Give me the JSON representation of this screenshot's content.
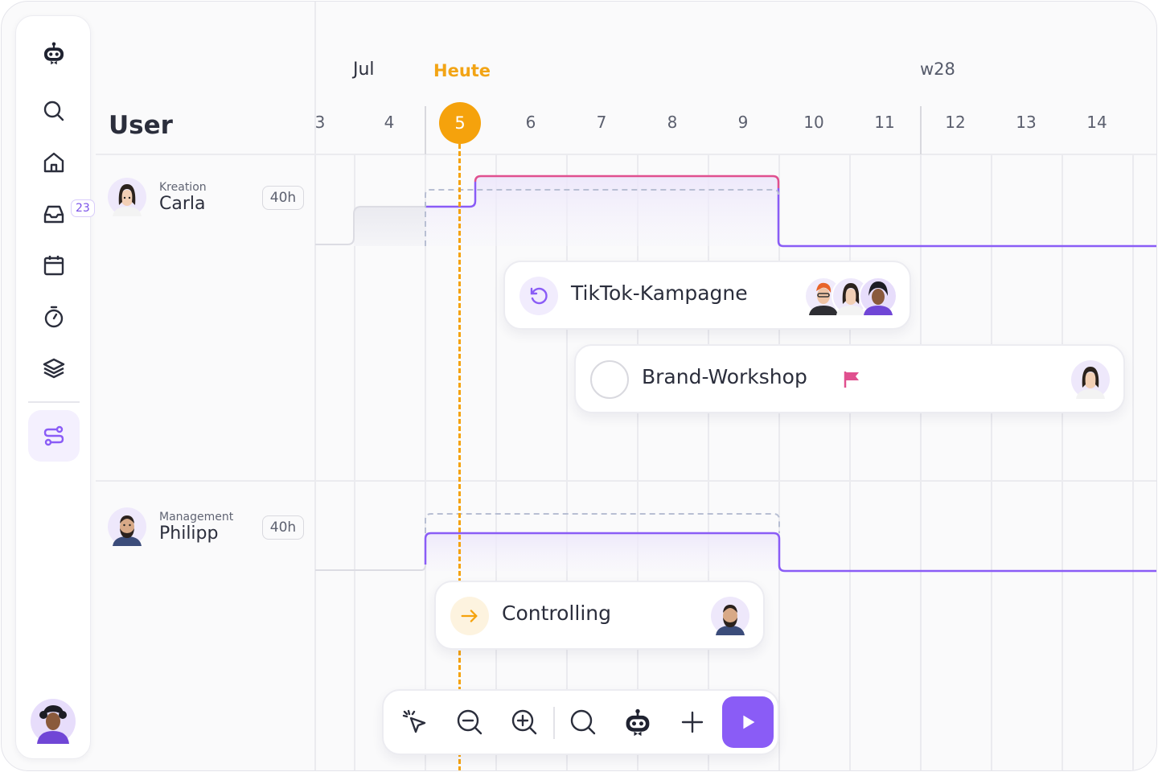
{
  "colors": {
    "accent": "#8a5cf6",
    "today": "#f5a20c",
    "overload": "#e0508f",
    "capacity_dashed": "#b8bfd3"
  },
  "sidebar": {
    "items": [
      {
        "icon": "robot-logo-icon"
      },
      {
        "icon": "search-icon"
      },
      {
        "icon": "home-icon"
      },
      {
        "icon": "inbox-icon",
        "badge": "23"
      },
      {
        "icon": "calendar-icon"
      },
      {
        "icon": "stopwatch-icon"
      },
      {
        "icon": "layers-icon"
      },
      {
        "icon": "workload-icon",
        "active": true
      }
    ]
  },
  "user_column": {
    "title": "User",
    "users": [
      {
        "role": "Kreation",
        "name": "Carla",
        "hours": "40h"
      },
      {
        "role": "Management",
        "name": "Philipp",
        "hours": "40h"
      }
    ]
  },
  "timeline": {
    "month": "Jul",
    "today_label": "Heute",
    "week": "w28",
    "days": [
      "3",
      "4",
      "5",
      "6",
      "7",
      "8",
      "9",
      "10",
      "11",
      "12",
      "13",
      "14"
    ],
    "today": "5"
  },
  "tasks": [
    {
      "title": "TikTok-Kampagne",
      "status_icon": "recurring-icon",
      "assignees": 3
    },
    {
      "title": "Brand-Workshop",
      "status_icon": "empty-circle-icon",
      "flag": "flag-icon",
      "assignees": 1
    },
    {
      "title": "Controlling",
      "status_icon": "arrow-right-icon",
      "assignees": 1
    }
  ],
  "toolbar": {
    "tools": [
      "cursor-click-icon",
      "zoom-out-icon",
      "zoom-in-icon",
      "search-icon",
      "robot-icon",
      "plus-icon",
      "play-icon"
    ]
  }
}
